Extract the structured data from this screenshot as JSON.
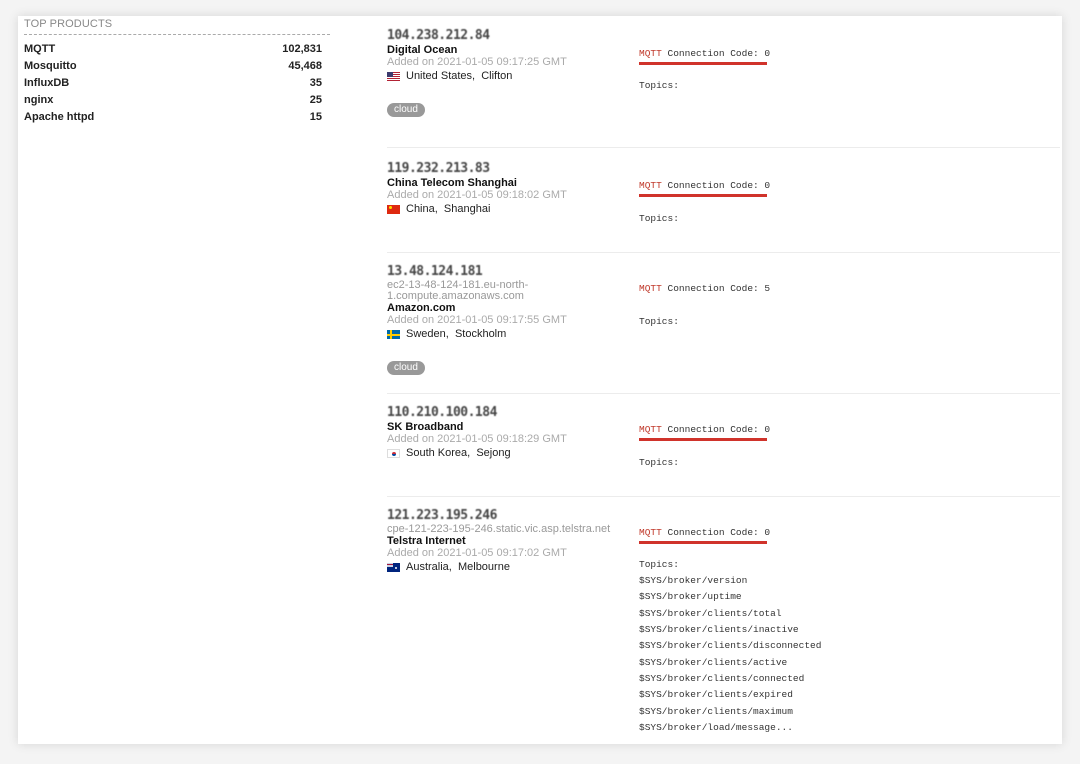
{
  "top_products": {
    "title": "TOP PRODUCTS",
    "items": [
      {
        "name": "MQTT",
        "count": "102,831"
      },
      {
        "name": "Mosquitto",
        "count": "45,468"
      },
      {
        "name": "InfluxDB",
        "count": "35"
      },
      {
        "name": "nginx",
        "count": "25"
      },
      {
        "name": "Apache httpd",
        "count": "15"
      }
    ]
  },
  "results": [
    {
      "ip": "104.238.212.84",
      "hostname": "",
      "org": "Digital Ocean",
      "added": "Added on 2021-01-05 09:17:25 GMT",
      "country": "United States",
      "city": "Clifton",
      "flag": "us-flag-icon",
      "tag": "cloud",
      "protocol": "MQTT",
      "code_text": " Connection Code: 0",
      "topics_label": "Topics:",
      "topics": []
    },
    {
      "ip": "119.232.213.83",
      "hostname": "",
      "org": "China Telecom Shanghai",
      "added": "Added on 2021-01-05 09:18:02 GMT",
      "country": "China",
      "city": "Shanghai",
      "flag": "cn-flag-icon",
      "tag": "",
      "protocol": "MQTT",
      "code_text": " Connection Code: 0",
      "topics_label": "Topics:",
      "topics": []
    },
    {
      "ip": "13.48.124.181",
      "hostname": "ec2-13-48-124-181.eu-north-1.compute.amazonaws.com",
      "org": "Amazon.com",
      "added": "Added on 2021-01-05 09:17:55 GMT",
      "country": "Sweden",
      "city": "Stockholm",
      "flag": "se-flag-icon",
      "tag": "cloud",
      "protocol": "MQTT",
      "code_text": " Connection Code: 5",
      "topics_label": "Topics:",
      "topics": []
    },
    {
      "ip": "110.210.100.184",
      "hostname": "",
      "org": "SK Broadband",
      "added": "Added on 2021-01-05 09:18:29 GMT",
      "country": "South Korea",
      "city": "Sejong",
      "flag": "kr-flag-icon",
      "tag": "",
      "protocol": "MQTT",
      "code_text": " Connection Code: 0",
      "topics_label": "Topics:",
      "topics": []
    },
    {
      "ip": "121.223.195.246",
      "hostname": "cpe-121-223-195-246.static.vic.asp.telstra.net",
      "org": "Telstra Internet",
      "added": "Added on 2021-01-05 09:17:02 GMT",
      "country": "Australia",
      "city": "Melbourne",
      "flag": "au-flag-icon",
      "tag": "",
      "protocol": "MQTT",
      "code_text": " Connection Code: 0",
      "topics_label": "Topics:",
      "topics": [
        "$SYS/broker/version",
        "$SYS/broker/uptime",
        "$SYS/broker/clients/total",
        "$SYS/broker/clients/inactive",
        "$SYS/broker/clients/disconnected",
        "$SYS/broker/clients/active",
        "$SYS/broker/clients/connected",
        "$SYS/broker/clients/expired",
        "$SYS/broker/clients/maximum",
        "$SYS/broker/load/message..."
      ]
    }
  ]
}
